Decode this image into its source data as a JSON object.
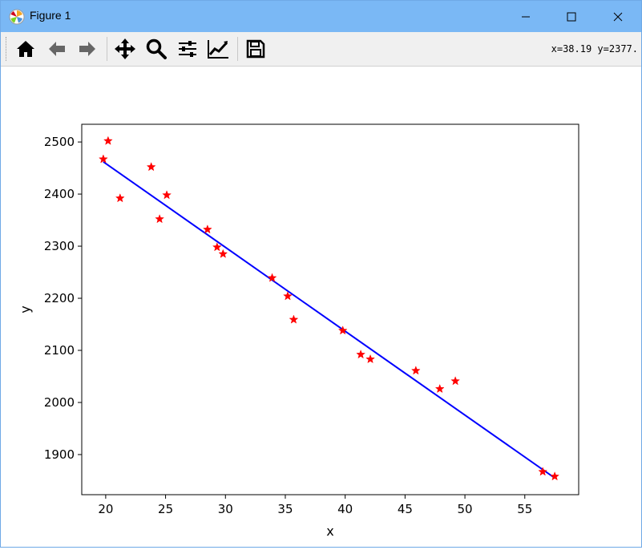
{
  "window": {
    "title": "Figure 1",
    "title_bar_color": "#7ab8f5"
  },
  "toolbar": {
    "buttons": [
      {
        "name": "home-icon",
        "label": "Home"
      },
      {
        "name": "back-icon",
        "label": "Back"
      },
      {
        "name": "forward-icon",
        "label": "Forward"
      },
      {
        "name": "pan-icon",
        "label": "Pan"
      },
      {
        "name": "zoom-icon",
        "label": "Zoom"
      },
      {
        "name": "configure-subplots-icon",
        "label": "Subplots"
      },
      {
        "name": "edit-axis-icon",
        "label": "Customize"
      },
      {
        "name": "save-icon",
        "label": "Save"
      }
    ],
    "coords_text": "x=38.19 y=2377."
  },
  "chart_data": {
    "type": "scatter",
    "title": "",
    "xlabel": "x",
    "ylabel": "y",
    "xlim": [
      18.0,
      59.5
    ],
    "ylim": [
      1823,
      2534
    ],
    "xticks": [
      20,
      25,
      30,
      35,
      40,
      45,
      50,
      55
    ],
    "yticks": [
      1900,
      2000,
      2100,
      2200,
      2300,
      2400,
      2500
    ],
    "grid": false,
    "series": [
      {
        "kind": "scatter",
        "marker": "star",
        "color": "#ff0000",
        "points": [
          [
            19.8,
            2467
          ],
          [
            20.2,
            2502
          ],
          [
            21.2,
            2392
          ],
          [
            23.8,
            2452
          ],
          [
            24.5,
            2352
          ],
          [
            25.1,
            2398
          ],
          [
            28.5,
            2332
          ],
          [
            29.3,
            2298
          ],
          [
            29.8,
            2285
          ],
          [
            33.9,
            2239
          ],
          [
            35.2,
            2204
          ],
          [
            35.7,
            2159
          ],
          [
            39.8,
            2138
          ],
          [
            41.3,
            2092
          ],
          [
            42.1,
            2083
          ],
          [
            45.9,
            2061
          ],
          [
            47.9,
            2026
          ],
          [
            49.2,
            2041
          ],
          [
            56.5,
            1867
          ],
          [
            57.5,
            1858
          ]
        ]
      },
      {
        "kind": "line",
        "color": "#0000ff",
        "points": [
          [
            19.8,
            2462
          ],
          [
            57.5,
            1855
          ]
        ]
      }
    ]
  }
}
